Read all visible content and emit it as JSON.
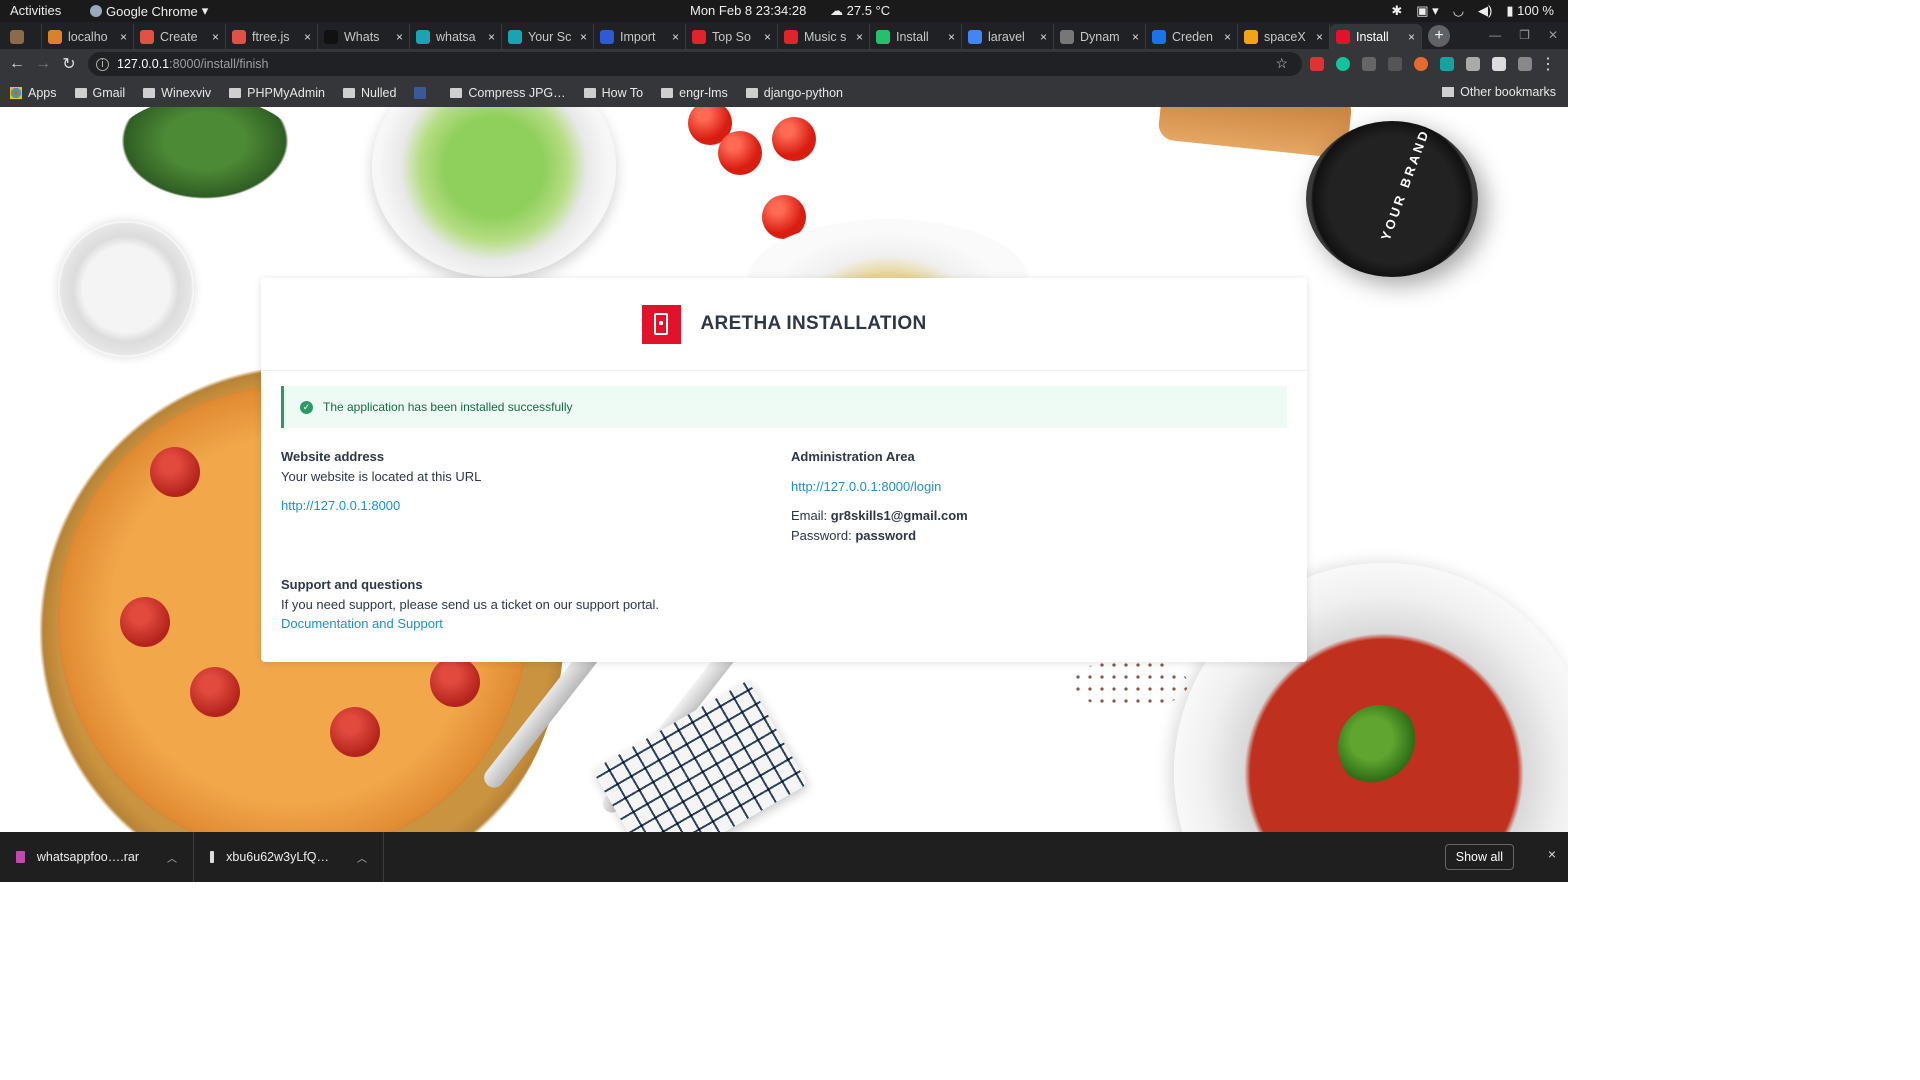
{
  "os_bar": {
    "activities": "Activities",
    "app_name": "Google Chrome",
    "clock": "Mon Feb 8  23:34:28",
    "weather": "27.5 °C",
    "battery": "100 %"
  },
  "tabs": [
    {
      "label": "",
      "close": "",
      "color": "#8a6b4a"
    },
    {
      "label": "localho",
      "close": "×",
      "color": "#d9822b"
    },
    {
      "label": "Create",
      "close": "×",
      "color": "#e05243"
    },
    {
      "label": "ftree.js",
      "close": "×",
      "color": "#e05243"
    },
    {
      "label": "Whats",
      "close": "×",
      "color": "#111111"
    },
    {
      "label": "whatsa",
      "close": "×",
      "color": "#1aa3b3"
    },
    {
      "label": "Your Sc",
      "close": "×",
      "color": "#1aa3b3"
    },
    {
      "label": "Import",
      "close": "×",
      "color": "#2d5bd8"
    },
    {
      "label": "Top So",
      "close": "×",
      "color": "#e0242b"
    },
    {
      "label": "Music s",
      "close": "×",
      "color": "#e0242b"
    },
    {
      "label": "Install",
      "close": "×",
      "color": "#25c06d"
    },
    {
      "label": "laravel",
      "close": "×",
      "color": "#4285f4"
    },
    {
      "label": "Dynam",
      "close": "×",
      "color": "#777777"
    },
    {
      "label": "Creden",
      "close": "×",
      "color": "#1a73e8"
    },
    {
      "label": "spaceX",
      "close": "×",
      "color": "#f2a317"
    },
    {
      "label": "Install",
      "close": "×",
      "color": "#e3122b"
    }
  ],
  "new_tab": "+",
  "address": {
    "host": "127.0.0.1",
    "path": ":8000/install/finish",
    "info": "i",
    "star": "☆"
  },
  "nav": {
    "back": "←",
    "forward": "→",
    "reload": "↻",
    "menu": "⋮"
  },
  "bookmarks": [
    {
      "label": "Apps"
    },
    {
      "label": "Gmail"
    },
    {
      "label": "Winexviv"
    },
    {
      "label": "PHPMyAdmin"
    },
    {
      "label": "Nulled"
    },
    {
      "label": ""
    },
    {
      "label": "Compress JPG…"
    },
    {
      "label": "How To"
    },
    {
      "label": "engr-lms"
    },
    {
      "label": "django-python"
    }
  ],
  "other_bookmarks": "Other bookmarks",
  "decor": {
    "jar_text": "YOUR BRAND"
  },
  "install": {
    "title": "ARETHA INSTALLATION",
    "success_message": "The application has been installed successfully",
    "website": {
      "heading": "Website address",
      "text": "Your website is located at this URL",
      "link": "http://127.0.0.1:8000"
    },
    "admin": {
      "heading": "Administration Area",
      "link": "http://127.0.0.1:8000/login",
      "email_label": "Email:",
      "email": "gr8skills1@gmail.com",
      "password_label": "Password:",
      "password": "password"
    },
    "support": {
      "heading": "Support and questions",
      "text": "If you need support, please send us a ticket on our support portal.",
      "link": "Documentation and Support"
    }
  },
  "downloads": [
    {
      "name": "whatsappfoo….rar",
      "color": "#c04ab0"
    },
    {
      "name": "xbu6u62w3yLfQ…",
      "color": "#dddddd"
    }
  ],
  "show_all": "Show all",
  "shelf_close": "×",
  "accent_colors": {
    "brand_red": "#e3122b",
    "success_green": "#2b9a66",
    "link_blue": "#1d8fd6"
  }
}
